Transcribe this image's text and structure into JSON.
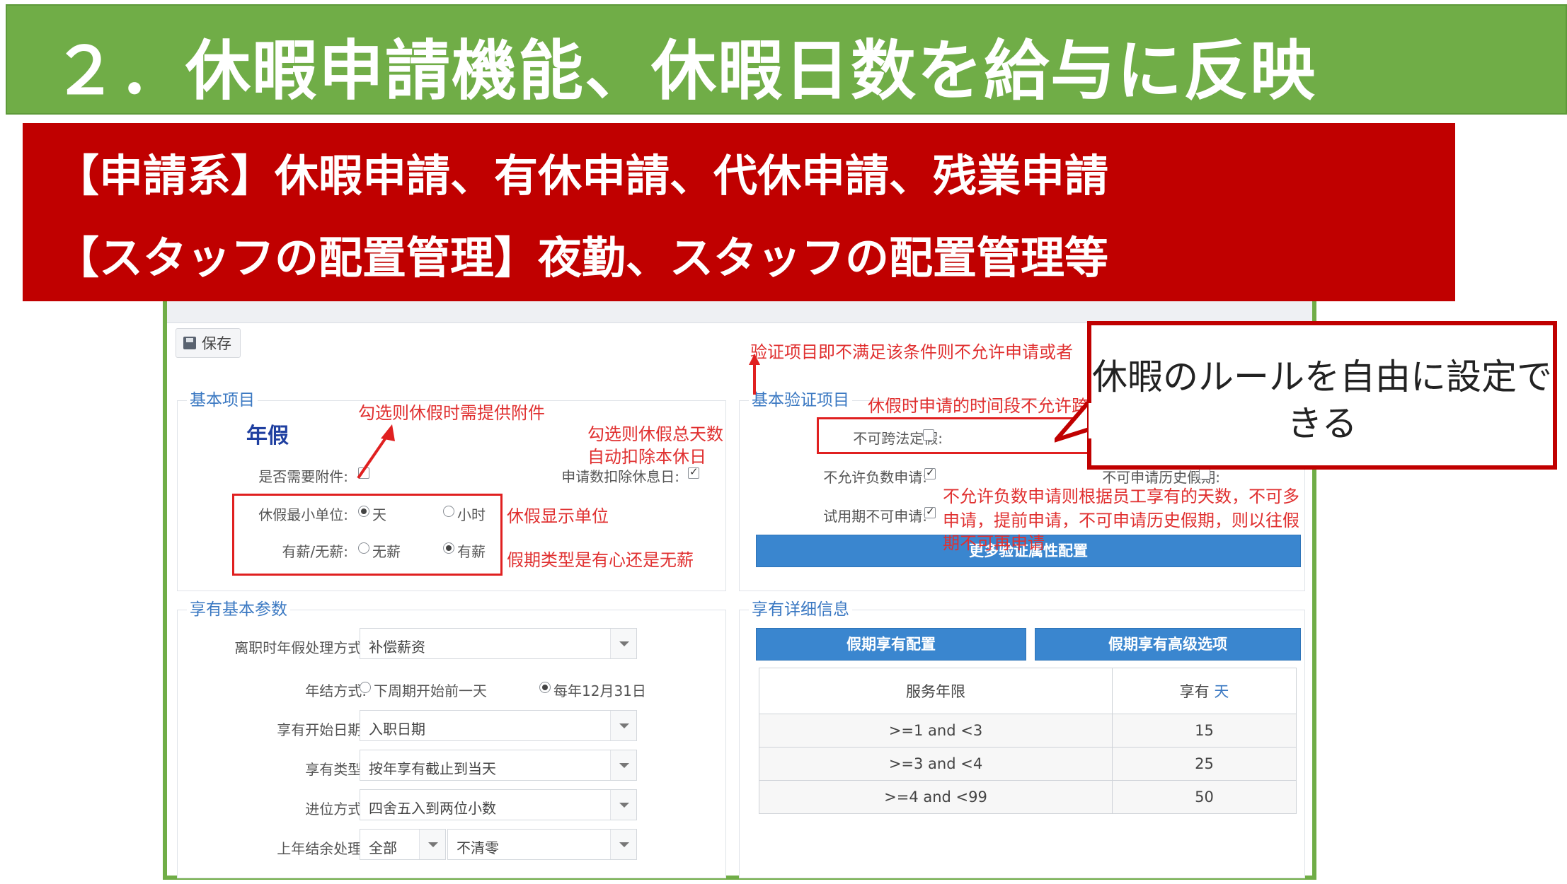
{
  "slide": {
    "title": "２．休暇申請機能、休暇日数を給与に反映",
    "banner_line1": "【申請系】休暇申請、有休申請、代休申請、残業申請",
    "banner_line2": "【スタッフの配置管理】夜勤、スタッフの配置管理等",
    "callout": "休暇のルールを自由に設定できる"
  },
  "toolbar": {
    "save_label": "保存"
  },
  "basic": {
    "legend": "基本项目",
    "leave_name": "年假",
    "attachment_label": "是否需要附件:",
    "deduct_label": "申请数扣除休息日:",
    "min_unit_label": "休假最小单位:",
    "min_unit_options": [
      "天",
      "小时"
    ],
    "paid_label": "有薪/无薪:",
    "paid_options": [
      "无薪",
      "有薪"
    ]
  },
  "verify": {
    "legend": "基本验证项目",
    "cross_holiday_label": "不可跨法定假:",
    "no_negative_label": "不允许负数申请:",
    "no_history_label": "不可申请历史假期:",
    "probation_label": "试用期不可申请:",
    "more_button": "更多验证属性配置"
  },
  "params": {
    "legend": "享有基本参数",
    "rows": [
      {
        "label": "离职时年假处理方式:",
        "value": "补偿薪资"
      },
      {
        "label": "享有开始日期:",
        "value": "入职日期"
      },
      {
        "label": "享有类型:",
        "value": "按年享有截止到当天"
      },
      {
        "label": "进位方式:",
        "value": "四舍五入到两位小数"
      }
    ],
    "settle_label": "年结方式:",
    "settle_options": [
      "下周期开始前一天",
      "每年12月31日"
    ],
    "carry_label": "上年结余处理:",
    "carry_value_1": "全部",
    "carry_value_2": "不清零"
  },
  "detail": {
    "legend": "享有详细信息",
    "btn_config": "假期享有配置",
    "btn_advanced": "假期享有高级选项",
    "col_years": "服务年限",
    "col_days_prefix": "享有",
    "col_days_unit": "天",
    "rows": [
      {
        "range": ">=1 and <3",
        "days": "15"
      },
      {
        "range": ">=3 and <4",
        "days": "25"
      },
      {
        "range": ">=4 and <99",
        "days": "50"
      }
    ]
  },
  "annotations": {
    "attach": "勾选则休假时需提供附件",
    "deduct_1": "勾选则休假总天数",
    "deduct_2": "自动扣除本休日",
    "unit": "休假显示单位",
    "paid": "假期类型是有心还是无薪",
    "verify_top": "验证项目即不满足该条件则不允许申请或者",
    "verify_period": "休假时申请的时间段不允许跨",
    "neg_1": "不允许负数申请则根据员工享有的天数，不可多",
    "neg_2": "申请，提前申请，不可申请历史假期，则以往假",
    "neg_3": "期不可再申请"
  },
  "colors": {
    "title_green": "#70ad47",
    "banner_red": "#c00000",
    "annotation_red": "#e03030",
    "button_blue": "#3a86cf"
  }
}
